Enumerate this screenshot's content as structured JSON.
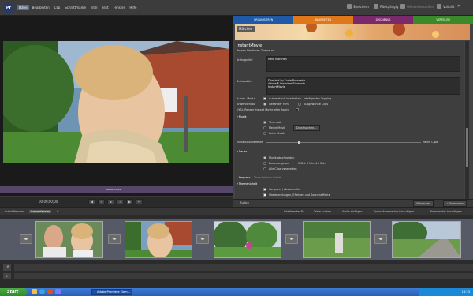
{
  "menu": [
    "Datei",
    "Bearbeiten",
    "Clip",
    "Schnittmarke",
    "Titel",
    "Text",
    "Fenster",
    "Hilfe"
  ],
  "toolbar_right": {
    "speichern": "Speichern",
    "rueckgaengig": "Rückgängig",
    "wiederherstellen": "Wiederherstellen",
    "vollbild": "Vollbild"
  },
  "tabs": [
    {
      "label": "ORGANISIEREN",
      "color": "#1f5aa8"
    },
    {
      "label": "BEARBEITEN",
      "color": "#e0781a"
    },
    {
      "label": "DISCNENUS",
      "color": "#7a2a6a"
    },
    {
      "label": "VERTEILEN",
      "color": "#3a8a2a"
    }
  ],
  "banner_tag": "Märchen",
  "scrub_label": "00:01:33:05",
  "timecode": "00;00;00;00",
  "panel": {
    "title": "InstantMovie",
    "subtitle": "Passen Sie dieses Thema an",
    "field1_label": "Anfangstitel",
    "field1_value": "Mein Märchen",
    "field2_label": "Schlusstitel",
    "field2_value": "Directed by Susie Brenneke\nAdobe® Premiere Elements\nInstantMovie",
    "auto_label": "Automatisch bearbeiten",
    "auto_sel": "Intelligentes Tagging",
    "auto_row1": "Anwenden auf",
    "auto_opt1": "Gesamter Film",
    "auto_opt2": "Ausgewählte Clips",
    "auto_row2": "UYSL_Render Instant Movie after Apply",
    "musik": "Musik",
    "musik_opt1": "Themusik",
    "musik_opt2": "Meine Musik",
    "musik_btn": "Durchsuchen...",
    "musik_opt3": "Keine Musik",
    "music_balance_left": "Musik/Soundeffekte",
    "music_balance_right": "Meine Clips",
    "dauer": "Dauer",
    "dauer_opt1": "Musik abschneiden",
    "dauer_opt2": "Dauer angeben",
    "dauer_fields": "0  Std. 0  Min. 40  Sek.",
    "dauer_opt3": "Alle Clips verwenden",
    "sequenz": "Sequenz",
    "sequenz_val": "Thematischer Inhalt",
    "themeninhalt": "Themeninhalt",
    "them_opt1": "Vorspann / Abspannfilm",
    "them_opt2": "Überblendungen, Effekten und Sonneneffekte"
  },
  "bottom_buttons": {
    "zurueck": "Zurück",
    "abbrechen": "Abbrechen",
    "anwenden": "Anwenden"
  },
  "timeline_tabs": [
    "Schnittfenster",
    "Szenenfenster"
  ],
  "timeline_tools": [
    "Intelligenter Fix",
    "Takte suchen",
    "Audio einfügen",
    "Sprachkommentar hinzufügen",
    "Kommentar hinzufügen"
  ],
  "taskbar": {
    "start": "Start",
    "task": "Adobe Premiere Elem...",
    "clock": "18:23"
  }
}
